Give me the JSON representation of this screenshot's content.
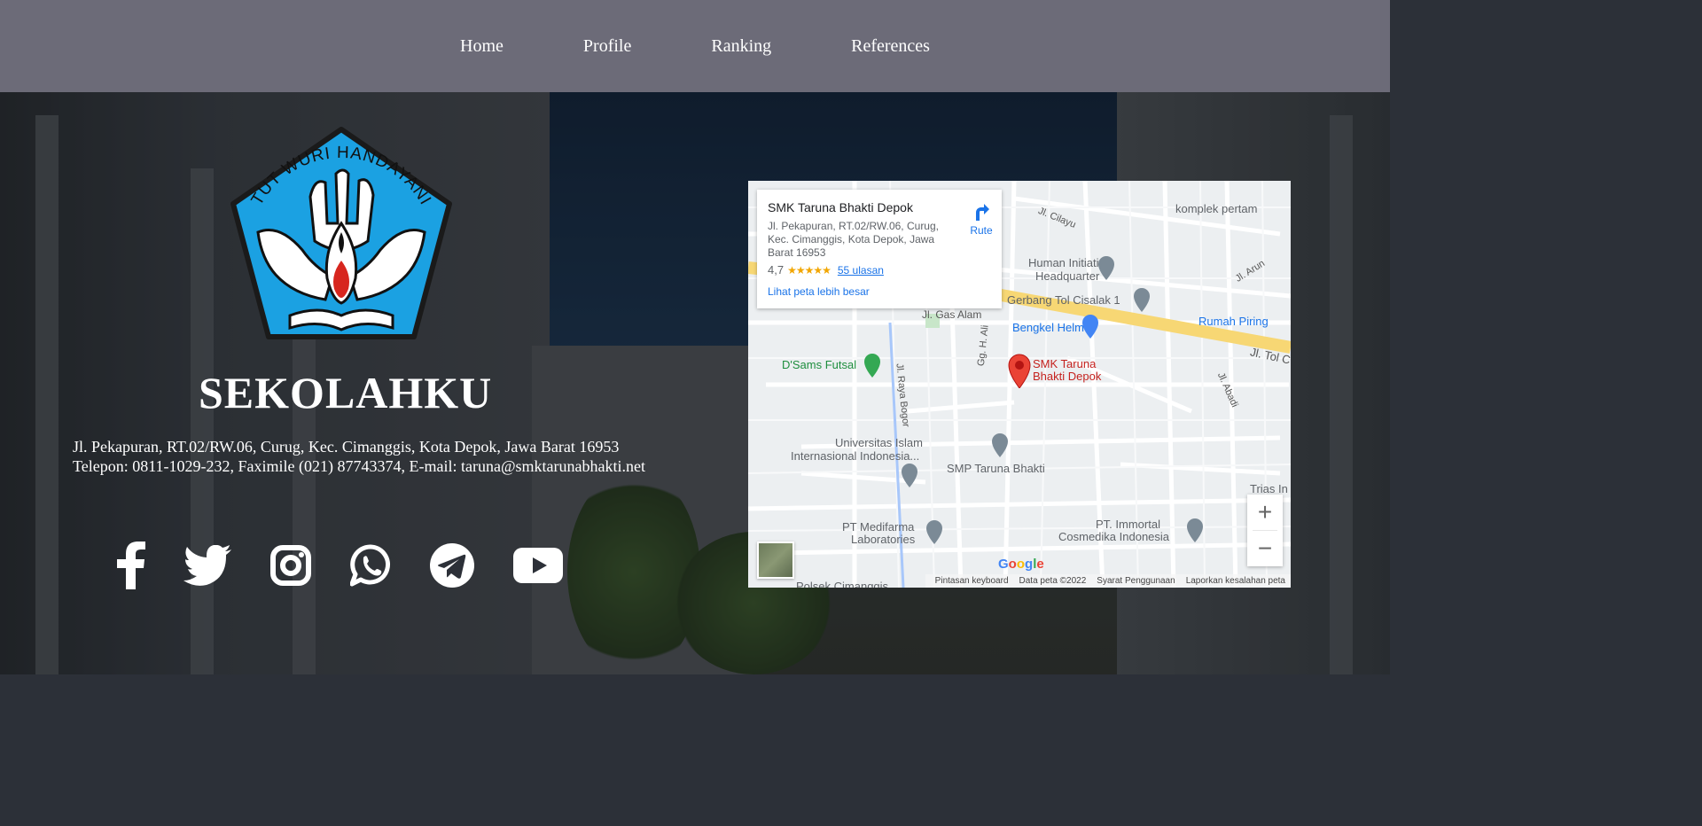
{
  "nav": {
    "items": [
      "Home",
      "Profile",
      "Ranking",
      "References"
    ]
  },
  "logo": {
    "motto": "TUT WURI HANDAYANI"
  },
  "school": {
    "name": "SEKOLAHKU",
    "address_line": "Jl. Pekapuran, RT.02/RW.06, Curug, Kec. Cimanggis, Kota Depok, Jawa Barat 16953",
    "contact_line": "Telepon: 0811-1029-232, Faximile (021) 87743374, E-mail: taruna@smktarunabhakti.net"
  },
  "socials": [
    "facebook-icon",
    "twitter-icon",
    "instagram-icon",
    "whatsapp-icon",
    "telegram-icon",
    "youtube-icon"
  ],
  "map": {
    "place_name": "SMK Taruna Bhakti Depok",
    "place_address": "Jl. Pekapuran, RT.02/RW.06, Curug, Kec. Cimanggis, Kota Depok, Jawa Barat 16953",
    "rating": "4,7",
    "stars": 4.7,
    "reviews": "55 ulasan",
    "larger_map": "Lihat peta lebih besar",
    "directions": "Rute",
    "labels": {
      "cilayu": "Jl. Cilayu",
      "komplek": "komplek pertam",
      "human": "Human Initiative",
      "headquarter": "Headquarter",
      "arun": "Jl. Arun",
      "gerbang": "Gerbang Tol Cisalak 1",
      "gas_alam": "Jl. Gas Alam",
      "rumah_piring": "Rumah Piring",
      "bengkel": "Bengkel Helm",
      "tol": "Jl. Tol C",
      "dsams": "D'Sams Futsal",
      "raya_bogor": "Jl. Raya Bogor",
      "h_ali": "Gg. H. Ali",
      "smk_line1": "SMK Taruna",
      "smk_line2": "Bhakti Depok",
      "abadi": "Jl. Abadi",
      "unii_1": "Universitas Islam",
      "unii_2": "Internasional Indonesia...",
      "smp": "SMP Taruna Bhakti",
      "trias": "Trias In",
      "medifarma_1": "PT Medifarma",
      "medifarma_2": "Laboratories",
      "immortal_1": "PT. Immortal",
      "immortal_2": "Cosmedika Indonesia",
      "polsek": "Polsek Cimanggis"
    },
    "google": "Google",
    "footer": {
      "keyboard": "Pintasan keyboard",
      "data": "Data peta ©2022",
      "terms": "Syarat Penggunaan",
      "report": "Laporkan kesalahan peta"
    },
    "zoom_in": "+",
    "zoom_out": "−"
  },
  "colors": {
    "nav_bg": "#6c6b78",
    "logo_blue": "#1ba1e2",
    "map_link": "#1a73e8",
    "pin_red": "#ea4335"
  }
}
